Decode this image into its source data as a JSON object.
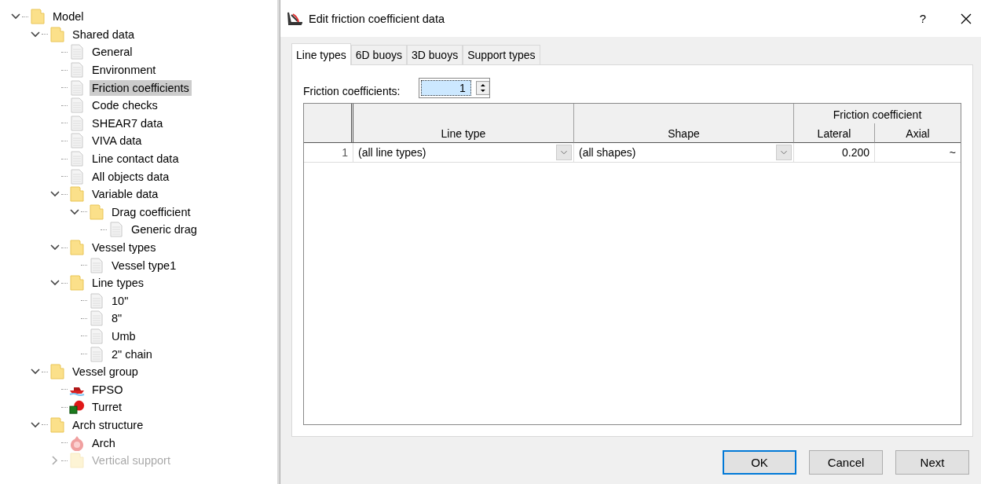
{
  "tree": [
    {
      "label": "Model",
      "kind": "folder",
      "expanded": true,
      "selected": false,
      "children": [
        {
          "label": "Shared data",
          "kind": "folder",
          "expanded": true,
          "selected": false,
          "children": [
            {
              "label": "General",
              "kind": "doc",
              "selected": false
            },
            {
              "label": "Environment",
              "kind": "doc",
              "selected": false
            },
            {
              "label": "Friction coefficients",
              "kind": "doc",
              "selected": true
            },
            {
              "label": "Code checks",
              "kind": "doc",
              "selected": false
            },
            {
              "label": "SHEAR7 data",
              "kind": "doc",
              "selected": false
            },
            {
              "label": "VIVA data",
              "kind": "doc",
              "selected": false
            },
            {
              "label": "Line contact data",
              "kind": "doc",
              "selected": false
            },
            {
              "label": "All objects data",
              "kind": "doc",
              "selected": false
            },
            {
              "label": "Variable data",
              "kind": "folder",
              "expanded": true,
              "selected": false,
              "children": [
                {
                  "label": "Drag coefficient",
                  "kind": "folder",
                  "expanded": true,
                  "selected": false,
                  "children": [
                    {
                      "label": "Generic drag",
                      "kind": "doc",
                      "selected": false
                    }
                  ]
                }
              ]
            },
            {
              "label": "Vessel types",
              "kind": "folder",
              "expanded": true,
              "selected": false,
              "children": [
                {
                  "label": "Vessel type1",
                  "kind": "doc",
                  "selected": false
                }
              ]
            },
            {
              "label": "Line types",
              "kind": "folder",
              "expanded": true,
              "selected": false,
              "children": [
                {
                  "label": "10\"",
                  "kind": "doc",
                  "selected": false
                },
                {
                  "label": "8\"",
                  "kind": "doc",
                  "selected": false
                },
                {
                  "label": "Umb",
                  "kind": "doc",
                  "selected": false
                },
                {
                  "label": "2\" chain",
                  "kind": "doc",
                  "selected": false
                }
              ]
            }
          ]
        },
        {
          "label": "Vessel group",
          "kind": "folder",
          "expanded": true,
          "selected": false,
          "children": [
            {
              "label": "FPSO",
              "kind": "vessel",
              "selected": false
            },
            {
              "label": "Turret",
              "kind": "turret",
              "selected": false
            }
          ]
        },
        {
          "label": "Arch structure",
          "kind": "folder",
          "expanded": true,
          "selected": false,
          "children": [
            {
              "label": "Arch",
              "kind": "arch",
              "selected": false
            },
            {
              "label": "Vertical support",
              "kind": "folder",
              "expanded": false,
              "selected": false
            }
          ]
        }
      ]
    }
  ],
  "dialog": {
    "title": "Edit friction coefficient data",
    "help": "?",
    "tabs": [
      {
        "label": "Line types",
        "selected": true
      },
      {
        "label": "6D buoys",
        "selected": false
      },
      {
        "label": "3D buoys",
        "selected": false
      },
      {
        "label": "Support types",
        "selected": false
      }
    ],
    "count_label": "Friction coefficients:",
    "count_value": "1",
    "table": {
      "group_header": "Friction coefficient",
      "columns": [
        "Line type",
        "Shape",
        "Lateral",
        "Axial"
      ],
      "rows": [
        {
          "number": "1",
          "line_type": "(all line types)",
          "shape": "(all shapes)",
          "lateral": "0.200",
          "axial": "~"
        }
      ]
    },
    "buttons": [
      {
        "label": "OK",
        "default": true
      },
      {
        "label": "Cancel",
        "default": false
      },
      {
        "label": "Next",
        "default": false
      }
    ]
  }
}
